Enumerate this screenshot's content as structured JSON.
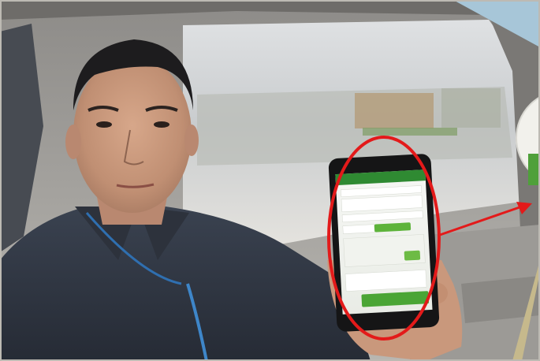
{
  "scene": {
    "description_tag": "photo",
    "colors": {
      "highlight_ellipse": "#e31a1a",
      "arrow": "#e31a1a",
      "app_header": "#2f8a32",
      "app_button": "#5db33a"
    }
  },
  "phone_screen": {
    "header_title": "",
    "button_primary": "",
    "button_bottom": ""
  }
}
